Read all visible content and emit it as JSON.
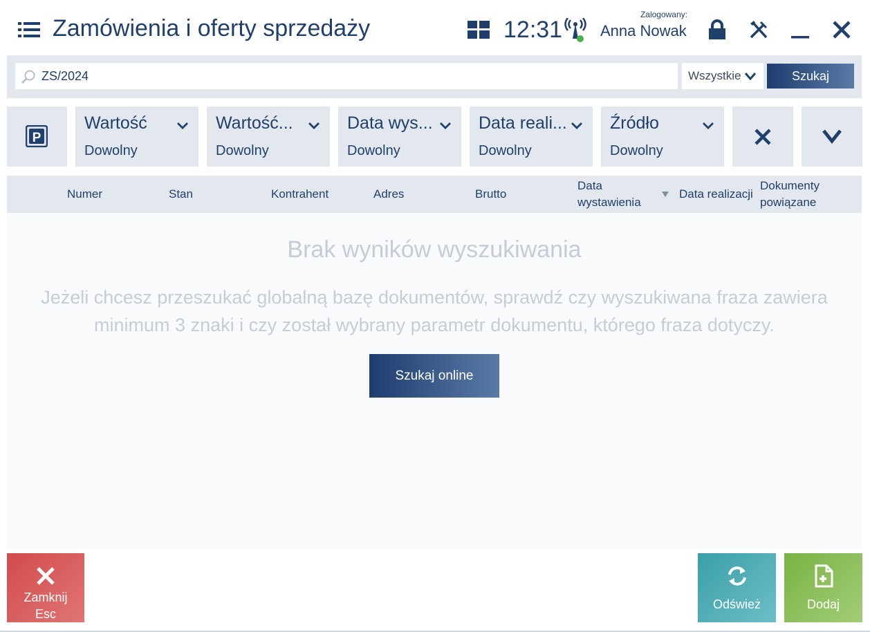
{
  "header": {
    "title": "Zamówienia i oferty sprzedaży",
    "time": "12:31",
    "logged_label": "Zalogowany:",
    "user_name": "Anna Nowak"
  },
  "search": {
    "value": "ZS/2024",
    "scope": "Wszystkie",
    "button_label": "Szukaj"
  },
  "filters": [
    {
      "title": "Wartość",
      "value": "Dowolny"
    },
    {
      "title": "Wartość...",
      "value": "Dowolny"
    },
    {
      "title": "Data wys...",
      "value": "Dowolny"
    },
    {
      "title": "Data reali...",
      "value": "Dowolny"
    },
    {
      "title": "Źródło",
      "value": "Dowolny"
    }
  ],
  "table": {
    "columns": [
      {
        "line1": "Numer",
        "line2": ""
      },
      {
        "line1": "Stan",
        "line2": ""
      },
      {
        "line1": "Kontrahent",
        "line2": ""
      },
      {
        "line1": "Adres",
        "line2": ""
      },
      {
        "line1": "Brutto",
        "line2": ""
      },
      {
        "line1": "Data",
        "line2": "wystawienia"
      },
      {
        "line1": "Data realizacji",
        "line2": ""
      },
      {
        "line1": "Dokumenty",
        "line2": "powiązane"
      }
    ]
  },
  "empty_state": {
    "title": "Brak wyników wyszukiwania",
    "description": "Jeżeli chcesz przeszukać globalną bazę dokumentów, sprawdź czy wyszukiwana fraza zawiera minimum 3 znaki i czy został wybrany parametr dokumentu, którego fraza dotyczy.",
    "button_label": "Szukaj online"
  },
  "bottom_buttons": {
    "close_label": "Zamknij",
    "close_shortcut": "Esc",
    "refresh_label": "Odśwież",
    "add_label": "Dodaj"
  },
  "colors": {
    "primary": "#1f3f6c",
    "panel": "#e3e8ef",
    "close": "#d24b4b",
    "refresh": "#3a9fa8",
    "add": "#7ab243",
    "status_online": "#4caf50"
  },
  "icons": [
    "menu-icon",
    "tiles-icon",
    "signal-icon",
    "lock-icon",
    "tools-icon",
    "minimize-icon",
    "close-icon",
    "search-icon",
    "chevron-down-icon",
    "parking-icon",
    "clear-filters-icon",
    "expand-icon",
    "sort-desc-icon",
    "refresh-icon",
    "add-document-icon"
  ]
}
